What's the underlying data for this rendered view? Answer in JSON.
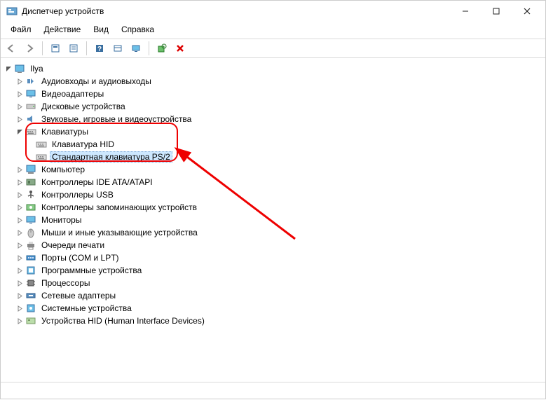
{
  "window": {
    "title": "Диспетчер устройств"
  },
  "menu": {
    "file": "Файл",
    "action": "Действие",
    "view": "Вид",
    "help": "Справка"
  },
  "toolbar_icons": {
    "back": "back-icon",
    "forward": "forward-icon",
    "show_hidden": "show-hidden-icon",
    "properties": "properties-icon",
    "help": "help-icon",
    "list": "list-icon",
    "monitor": "monitor-icon",
    "scan": "scan-icon",
    "delete": "delete-icon"
  },
  "tree": {
    "root": "Ilya",
    "nodes": [
      {
        "label": "Аудиовходы и аудиовыходы",
        "icon": "audio",
        "expanded": false
      },
      {
        "label": "Видеоадаптеры",
        "icon": "display",
        "expanded": false
      },
      {
        "label": "Дисковые устройства",
        "icon": "disk",
        "expanded": false
      },
      {
        "label": "Звуковые, игровые и видеоустройства",
        "icon": "sound",
        "expanded": false
      },
      {
        "label": "Клавиатуры",
        "icon": "keyboard",
        "expanded": true,
        "children": [
          {
            "label": "Клавиатура HID",
            "icon": "keyboard"
          },
          {
            "label": "Стандартная клавиатура PS/2",
            "icon": "keyboard",
            "selected": true
          }
        ]
      },
      {
        "label": "Компьютер",
        "icon": "computer",
        "expanded": false
      },
      {
        "label": "Контроллеры IDE ATA/ATAPI",
        "icon": "ide",
        "expanded": false
      },
      {
        "label": "Контроллеры USB",
        "icon": "usb",
        "expanded": false
      },
      {
        "label": "Контроллеры запоминающих устройств",
        "icon": "storage",
        "expanded": false
      },
      {
        "label": "Мониторы",
        "icon": "monitor",
        "expanded": false
      },
      {
        "label": "Мыши и иные указывающие устройства",
        "icon": "mouse",
        "expanded": false
      },
      {
        "label": "Очереди печати",
        "icon": "printer",
        "expanded": false
      },
      {
        "label": "Порты (COM и LPT)",
        "icon": "port",
        "expanded": false
      },
      {
        "label": "Программные устройства",
        "icon": "software",
        "expanded": false
      },
      {
        "label": "Процессоры",
        "icon": "cpu",
        "expanded": false
      },
      {
        "label": "Сетевые адаптеры",
        "icon": "network",
        "expanded": false
      },
      {
        "label": "Системные устройства",
        "icon": "system",
        "expanded": false
      },
      {
        "label": "Устройства HID (Human Interface Devices)",
        "icon": "hid",
        "expanded": false
      }
    ]
  }
}
